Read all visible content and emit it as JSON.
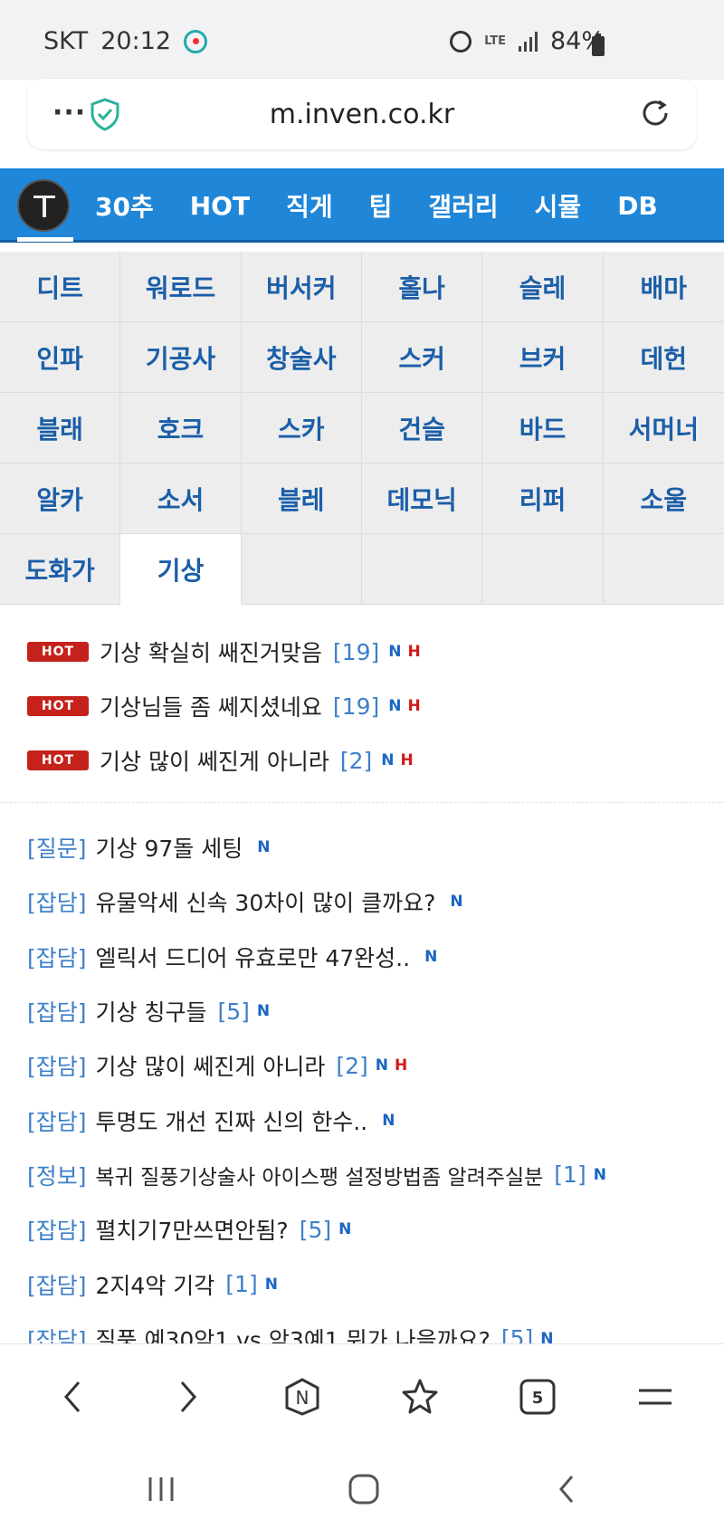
{
  "status": {
    "carrier": "SKT",
    "time": "20:12",
    "network": "LTE",
    "battery": "84%"
  },
  "urlbar": {
    "menu": "···",
    "url": "m.inven.co.kr"
  },
  "nav": {
    "items": [
      "30추",
      "HOT",
      "직게",
      "팁",
      "갤러리",
      "시뮬",
      "DB"
    ]
  },
  "classes": [
    "디트",
    "워로드",
    "버서커",
    "홀나",
    "슬레",
    "배마",
    "인파",
    "기공사",
    "창술사",
    "스커",
    "브커",
    "데헌",
    "블래",
    "호크",
    "스카",
    "건슬",
    "바드",
    "서머너",
    "알카",
    "소서",
    "블레",
    "데모닉",
    "리퍼",
    "소울",
    "도화가",
    "기상",
    "",
    "",
    "",
    ""
  ],
  "hot": {
    "badge": "HOT",
    "posts": [
      {
        "title": "기상 확실히 쌔진거맞음",
        "count": "[19]",
        "n": "N",
        "h": "H"
      },
      {
        "title": "기상님들 좀 쎄지셨네요",
        "count": "[19]",
        "n": "N",
        "h": "H"
      },
      {
        "title": "기상 많이 쎄진게 아니라",
        "count": "[2]",
        "n": "N",
        "h": "H"
      }
    ]
  },
  "posts": [
    {
      "category": "[질문]",
      "title": "기상 97돌 세팅",
      "count": "",
      "n": "N",
      "h": ""
    },
    {
      "category": "[잡담]",
      "title": "유물악세 신속 30차이 많이 클까요?",
      "count": "",
      "n": "N",
      "h": ""
    },
    {
      "category": "[잡담]",
      "title": "엘릭서 드디어 유효로만 47완성..",
      "count": "",
      "n": "N",
      "h": ""
    },
    {
      "category": "[잡담]",
      "title": "기상 칭구들",
      "count": "[5]",
      "n": "N",
      "h": ""
    },
    {
      "category": "[잡담]",
      "title": "기상 많이 쎄진게 아니라",
      "count": "[2]",
      "n": "N",
      "h": "H"
    },
    {
      "category": "[잡담]",
      "title": "투명도 개선 진짜 신의 한수..",
      "count": "",
      "n": "N",
      "h": ""
    },
    {
      "category": "[정보]",
      "title": "복귀 질풍기상술사 아이스팽 설정방법좀 알려주실분",
      "count": "[1]",
      "n": "N",
      "h": ""
    },
    {
      "category": "[잡담]",
      "title": "펼치기7만쓰면안됨?",
      "count": "[5]",
      "n": "N",
      "h": ""
    },
    {
      "category": "[잡담]",
      "title": "2지4악 기각",
      "count": "[1]",
      "n": "N",
      "h": ""
    },
    {
      "category": "[잡담]",
      "title": "질풍 예30악1 vs 악3예1 뭐가 나을까요?",
      "count": "[5]",
      "n": "N",
      "h": ""
    }
  ],
  "browser": {
    "tabs_count": "5",
    "home_letter": "N"
  },
  "colors": {
    "nav_blue": "#1f86d8",
    "class_text": "#1b5ea8",
    "hot_red": "#c4221b",
    "link_blue": "#3d7fc9"
  }
}
